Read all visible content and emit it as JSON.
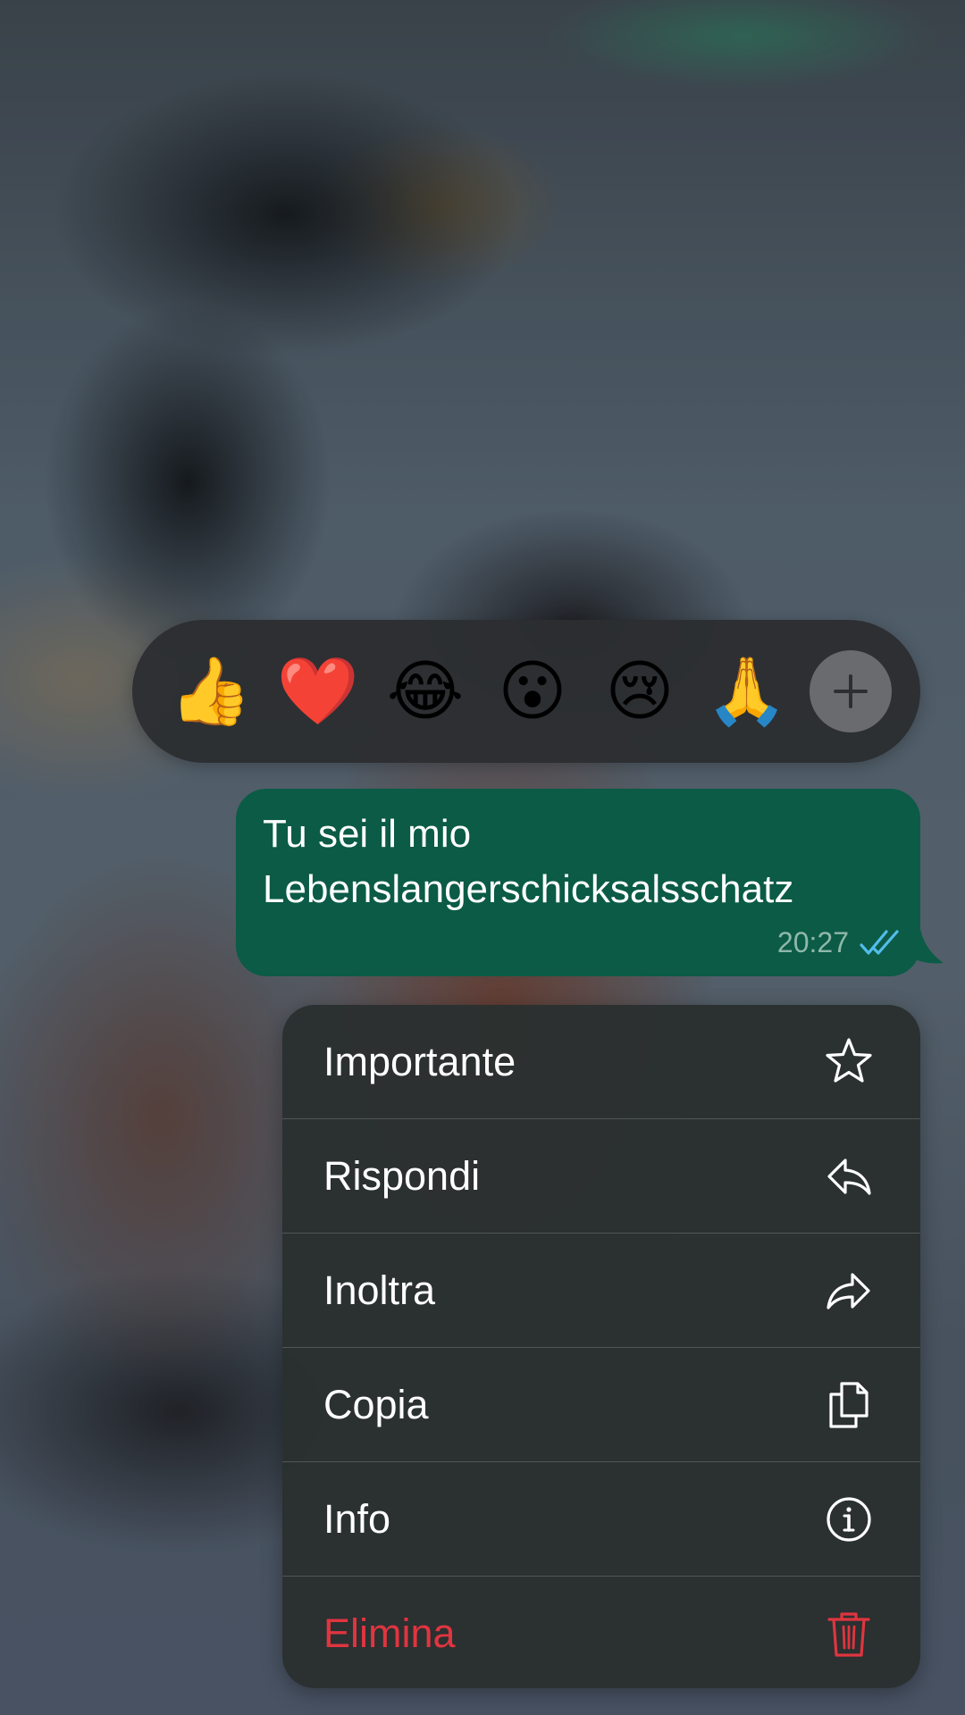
{
  "reactions": {
    "emojis": [
      {
        "glyph": "👍",
        "name": "thumbs-up"
      },
      {
        "glyph": "❤️",
        "name": "red-heart"
      },
      {
        "glyph": "😂",
        "name": "tears-of-joy"
      },
      {
        "glyph": "😮",
        "name": "open-mouth"
      },
      {
        "glyph": "😢",
        "name": "crying-face"
      },
      {
        "glyph": "🙏",
        "name": "folded-hands"
      }
    ],
    "add_icon": "plus-icon"
  },
  "message": {
    "text": "Tu sei il mio Lebenslangerschicksalsschatz",
    "time": "20:27",
    "status_icon": "double-check-icon",
    "status_color": "#53bdeb",
    "bubble_color": "#0b5b46"
  },
  "menu": {
    "items": [
      {
        "label": "Importante",
        "icon": "star-icon"
      },
      {
        "label": "Rispondi",
        "icon": "reply-icon"
      },
      {
        "label": "Inoltra",
        "icon": "forward-icon"
      },
      {
        "label": "Copia",
        "icon": "copy-icon"
      },
      {
        "label": "Info",
        "icon": "info-icon"
      },
      {
        "label": "Elimina",
        "icon": "trash-icon",
        "color": "#e0353f"
      }
    ]
  }
}
